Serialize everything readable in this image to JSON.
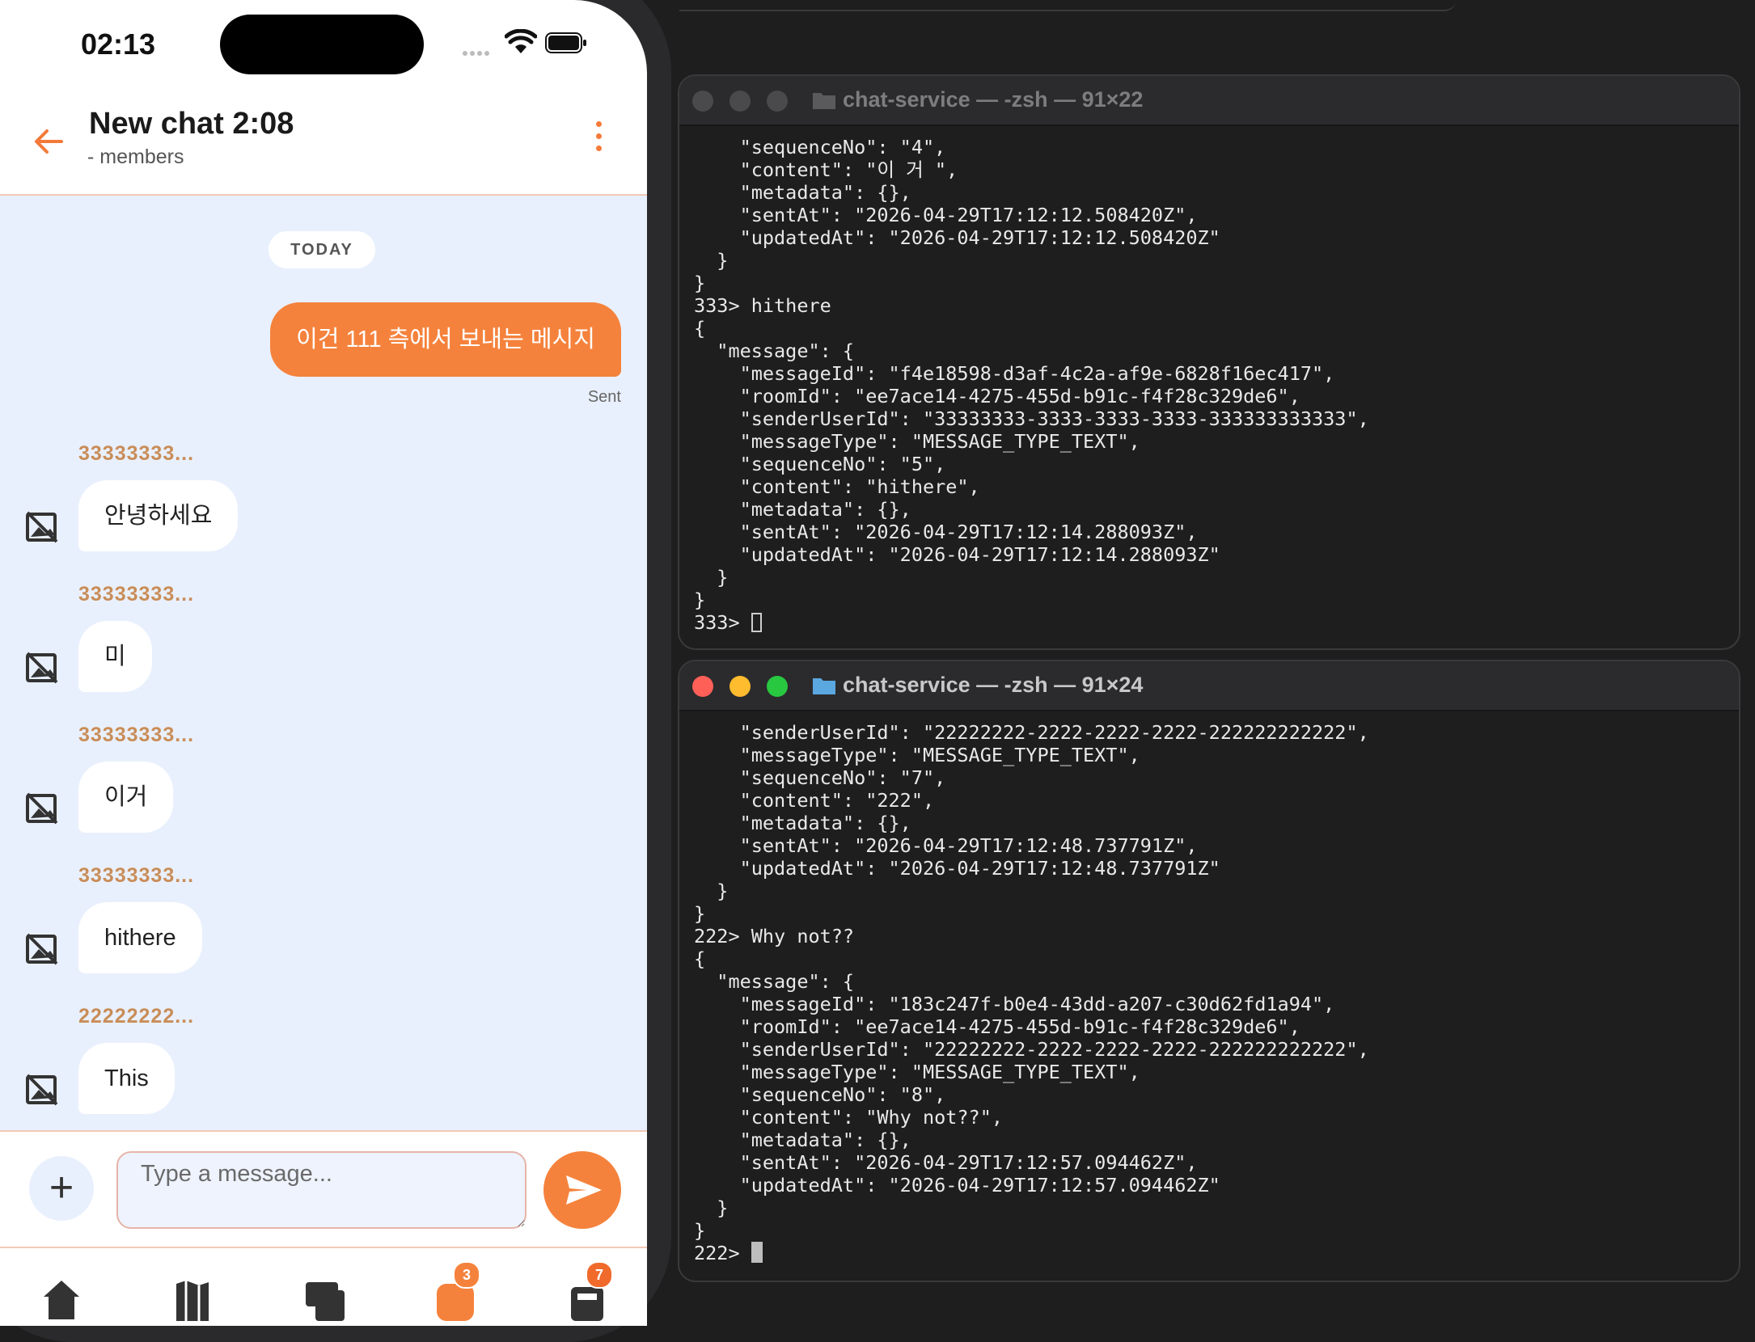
{
  "phone": {
    "status_bar": {
      "time": "02:13"
    },
    "header": {
      "title": "New chat 2:08",
      "subtitle": "- members"
    },
    "day_separator": "TODAY",
    "outgoing": {
      "text": "이건 111 측에서 보내는 메시지",
      "status": "Sent"
    },
    "messages": [
      {
        "sender": "33333333...",
        "text": "안녕하세요"
      },
      {
        "sender": "33333333...",
        "text": "미"
      },
      {
        "sender": "33333333...",
        "text": "이거"
      },
      {
        "sender": "33333333...",
        "text": "hithere"
      },
      {
        "sender": "22222222...",
        "text": "This"
      }
    ],
    "composer": {
      "placeholder": "Type a message..."
    },
    "nav": {
      "chat_badge": "3",
      "store_badge": "7"
    },
    "accent_color": "#f5823c"
  },
  "terminals": [
    {
      "title": "chat-service — -zsh — 91×22",
      "active": false,
      "lines": [
        "    \"sequenceNo\": \"4\",",
        "    \"content\": \"이 거 \",",
        "    \"metadata\": {},",
        "    \"sentAt\": \"2026-04-29T17:12:12.508420Z\",",
        "    \"updatedAt\": \"2026-04-29T17:12:12.508420Z\"",
        "  }",
        "}",
        "333> hithere",
        "{",
        "  \"message\": {",
        "    \"messageId\": \"f4e18598-d3af-4c2a-af9e-6828f16ec417\",",
        "    \"roomId\": \"ee7ace14-4275-455d-b91c-f4f28c329de6\",",
        "    \"senderUserId\": \"33333333-3333-3333-3333-333333333333\",",
        "    \"messageType\": \"MESSAGE_TYPE_TEXT\",",
        "    \"sequenceNo\": \"5\",",
        "    \"content\": \"hithere\",",
        "    \"metadata\": {},",
        "    \"sentAt\": \"2026-04-29T17:12:14.288093Z\",",
        "    \"updatedAt\": \"2026-04-29T17:12:14.288093Z\"",
        "  }",
        "}"
      ],
      "prompt": "333> "
    },
    {
      "title": "chat-service — -zsh — 91×24",
      "active": true,
      "lines": [
        "    \"senderUserId\": \"22222222-2222-2222-2222-222222222222\",",
        "    \"messageType\": \"MESSAGE_TYPE_TEXT\",",
        "    \"sequenceNo\": \"7\",",
        "    \"content\": \"222\",",
        "    \"metadata\": {},",
        "    \"sentAt\": \"2026-04-29T17:12:48.737791Z\",",
        "    \"updatedAt\": \"2026-04-29T17:12:48.737791Z\"",
        "  }",
        "}",
        "222> Why not??",
        "{",
        "  \"message\": {",
        "    \"messageId\": \"183c247f-b0e4-43dd-a207-c30d62fd1a94\",",
        "    \"roomId\": \"ee7ace14-4275-455d-b91c-f4f28c329de6\",",
        "    \"senderUserId\": \"22222222-2222-2222-2222-222222222222\",",
        "    \"messageType\": \"MESSAGE_TYPE_TEXT\",",
        "    \"sequenceNo\": \"8\",",
        "    \"content\": \"Why not??\",",
        "    \"metadata\": {},",
        "    \"sentAt\": \"2026-04-29T17:12:57.094462Z\",",
        "    \"updatedAt\": \"2026-04-29T17:12:57.094462Z\"",
        "  }",
        "}"
      ],
      "prompt": "222> "
    }
  ]
}
